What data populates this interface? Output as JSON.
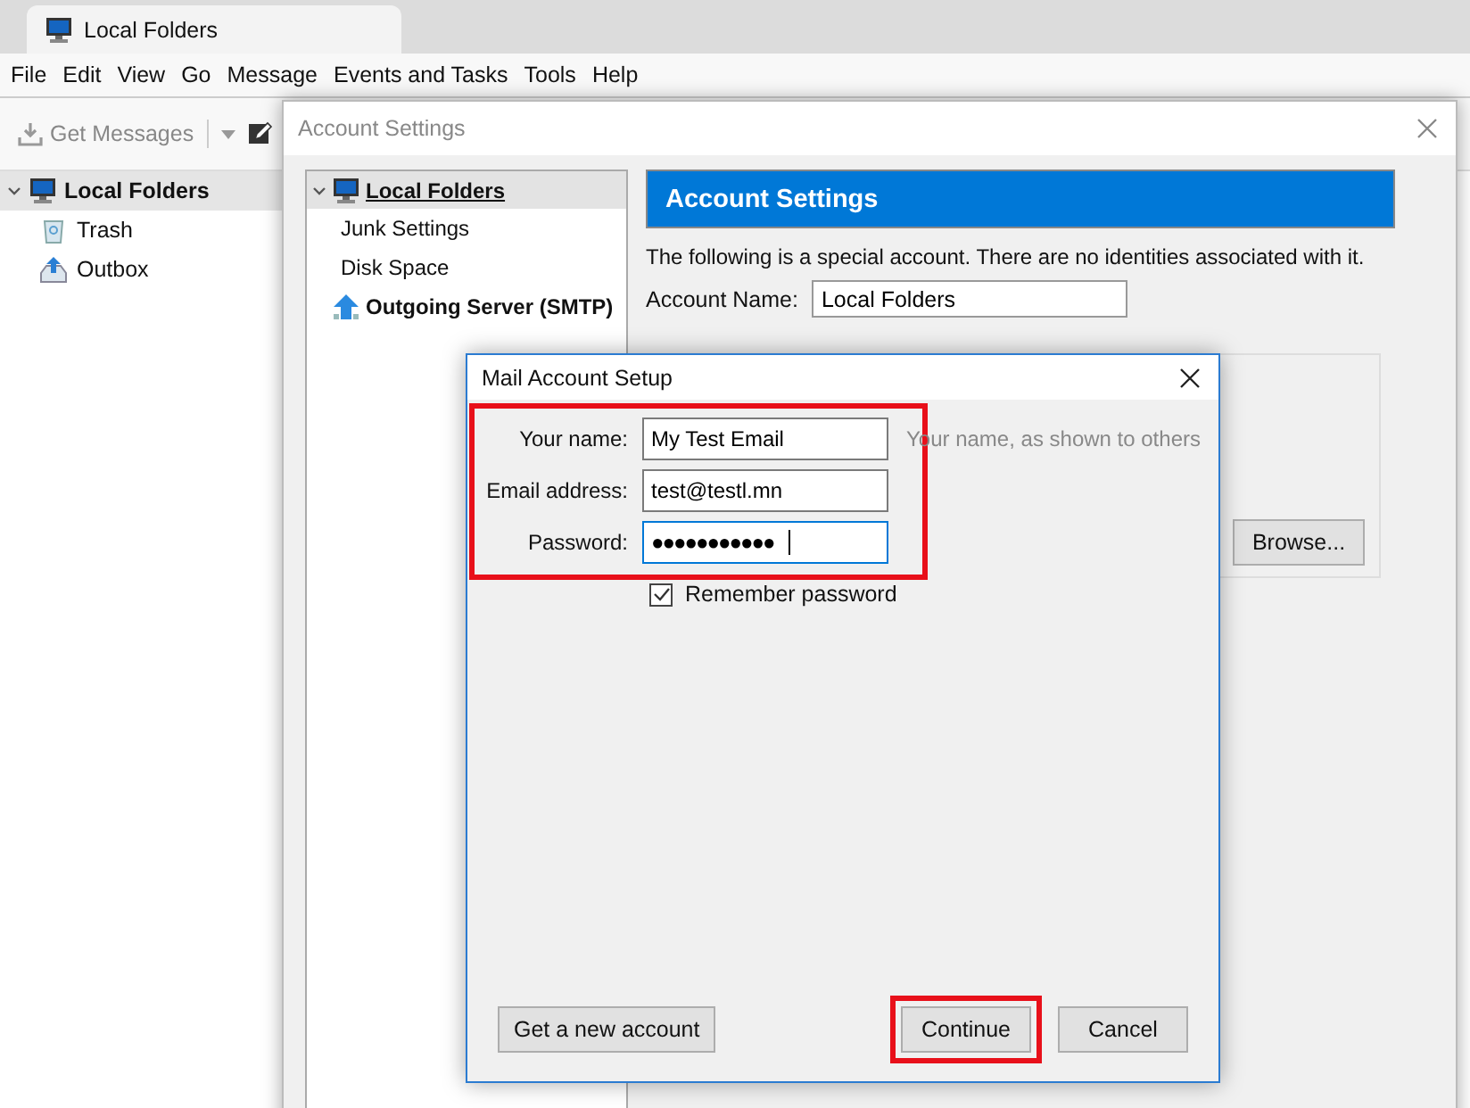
{
  "app_tab": {
    "title": "Local Folders"
  },
  "menu": [
    "File",
    "Edit",
    "View",
    "Go",
    "Message",
    "Events and Tasks",
    "Tools",
    "Help"
  ],
  "toolbar": {
    "get_messages": "Get Messages"
  },
  "folders": [
    {
      "name": "Local Folders",
      "kind": "account",
      "selected": true,
      "expanded": true,
      "children": [
        {
          "name": "Trash",
          "kind": "trash",
          "selected": false
        },
        {
          "name": "Outbox",
          "kind": "outbox",
          "selected": false
        }
      ]
    }
  ],
  "account_settings": {
    "title": "Account Settings",
    "tree": [
      {
        "label": "Local Folders",
        "kind": "account",
        "selected": true,
        "expanded": true,
        "children": [
          {
            "label": "Junk Settings",
            "selected": false
          },
          {
            "label": "Disk Space",
            "selected": false
          }
        ]
      },
      {
        "label": "Outgoing Server (SMTP)",
        "kind": "smtp",
        "selected": false
      }
    ],
    "header": "Account Settings",
    "description": "The following is a special account. There are no identities associated with it.",
    "account_name_label": "Account Name:",
    "account_name": "Local Folders",
    "browse_button": "Browse..."
  },
  "mail_setup": {
    "title": "Mail Account Setup",
    "fields_highlighted": true,
    "fields": [
      {
        "label": "Your name:",
        "value": "My Test Email",
        "hint": "Your name, as shown to others",
        "focused": false
      },
      {
        "label": "Email address:",
        "value": "test@testl.mn",
        "focused": false
      },
      {
        "label": "Password:",
        "value": "●●●●●●●●●●●",
        "focused": true
      }
    ],
    "remember_password": {
      "label": "Remember password",
      "checked": true
    },
    "secondary_button": {
      "label": "Get a new account",
      "highlighted": false
    },
    "buttons": [
      {
        "label": "Continue",
        "highlighted": true
      },
      {
        "label": "Cancel",
        "highlighted": false
      }
    ]
  }
}
